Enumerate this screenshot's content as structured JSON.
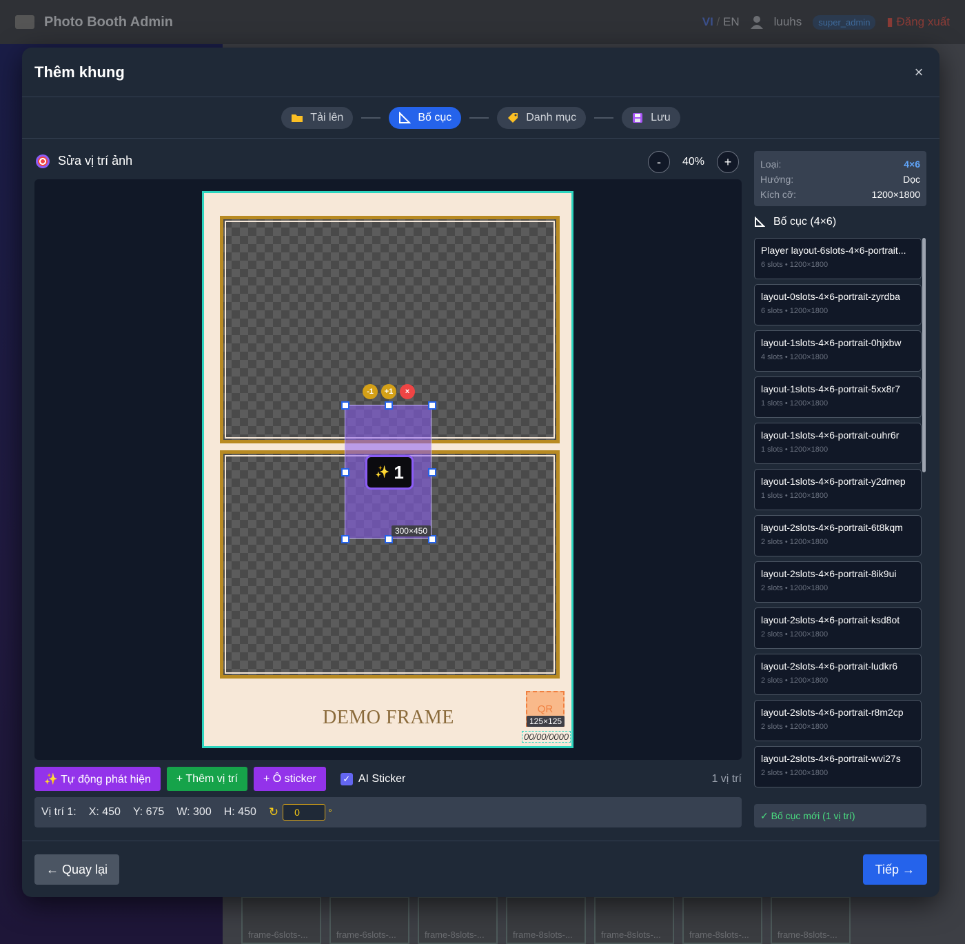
{
  "app": {
    "title": "Photo Booth Admin",
    "lang_vi": "VI",
    "lang_sep": "/",
    "lang_en": "EN",
    "username": "luuhs",
    "role": "super_admin",
    "logout": "Đăng xuất"
  },
  "background_thumbs": [
    "frame-6slots-...",
    "frame-6slots-...",
    "frame-8slots-...",
    "frame-8slots-...",
    "frame-8slots-...",
    "frame-8slots-...",
    "frame-8slots-..."
  ],
  "modal": {
    "title": "Thêm khung",
    "close": "×"
  },
  "steps": [
    {
      "label": "Tải lên",
      "icon": "folder-icon",
      "active": false
    },
    {
      "label": "Bố cục",
      "icon": "layout-icon",
      "active": true
    },
    {
      "label": "Danh mục",
      "icon": "tag-icon",
      "active": false
    },
    {
      "label": "Lưu",
      "icon": "save-icon",
      "active": false
    }
  ],
  "editor": {
    "title": "Sửa vị trí ảnh",
    "zoom_minus": "-",
    "zoom": "40%",
    "zoom_plus": "+"
  },
  "frame": {
    "demo_text": "DEMO FRAME",
    "qr_label": "QR",
    "qr_size": "125×125",
    "date_placeholder": "00/00/0000"
  },
  "selection": {
    "minus": "-1",
    "plus": "+1",
    "delete": "×",
    "badge_icon": "✨",
    "badge_number": "1",
    "size": "300×450"
  },
  "toolbar": {
    "auto_detect": "✨ Tự động phát hiện",
    "add_position": "+ Thêm vị trí",
    "add_sticker": "+ Ô sticker",
    "ai_sticker": "AI Sticker",
    "ai_sticker_checked": true,
    "count": "1 vị trí"
  },
  "position": {
    "label": "Vị trí 1:",
    "x": "X: 450",
    "y": "Y: 675",
    "w": "W: 300",
    "h": "H: 450",
    "rotation": "0",
    "deg": "°"
  },
  "info": {
    "type_key": "Loại:",
    "type_val": "4×6",
    "orient_key": "Hướng:",
    "orient_val": "Dọc",
    "size_key": "Kích cỡ:",
    "size_val": "1200×1800"
  },
  "layouts": {
    "heading": "Bố cục (4×6)",
    "items": [
      {
        "name": "Player layout-6slots-4×6-portrait...",
        "meta": "6 slots • 1200×1800"
      },
      {
        "name": "layout-0slots-4×6-portrait-zyrdba",
        "meta": "6 slots • 1200×1800"
      },
      {
        "name": "layout-1slots-4×6-portrait-0hjxbw",
        "meta": "4 slots • 1200×1800"
      },
      {
        "name": "layout-1slots-4×6-portrait-5xx8r7",
        "meta": "1 slots • 1200×1800"
      },
      {
        "name": "layout-1slots-4×6-portrait-ouhr6r",
        "meta": "1 slots • 1200×1800"
      },
      {
        "name": "layout-1slots-4×6-portrait-y2dmep",
        "meta": "1 slots • 1200×1800"
      },
      {
        "name": "layout-2slots-4×6-portrait-6t8kqm",
        "meta": "2 slots • 1200×1800"
      },
      {
        "name": "layout-2slots-4×6-portrait-8ik9ui",
        "meta": "2 slots • 1200×1800"
      },
      {
        "name": "layout-2slots-4×6-portrait-ksd8ot",
        "meta": "2 slots • 1200×1800"
      },
      {
        "name": "layout-2slots-4×6-portrait-ludkr6",
        "meta": "2 slots • 1200×1800"
      },
      {
        "name": "layout-2slots-4×6-portrait-r8m2cp",
        "meta": "2 slots • 1200×1800"
      },
      {
        "name": "layout-2slots-4×6-portrait-wvi27s",
        "meta": "2 slots • 1200×1800"
      }
    ],
    "new_layout": "✓ Bố cục mới (1 vị trí)"
  },
  "footer": {
    "back": "← Quay lại",
    "next": "Tiếp →"
  },
  "colors": {
    "accent": "#2563eb",
    "purple": "#9333ea",
    "green": "#16a34a",
    "frame_border": "#2dd4bf",
    "slot_border": "#b88a22"
  }
}
